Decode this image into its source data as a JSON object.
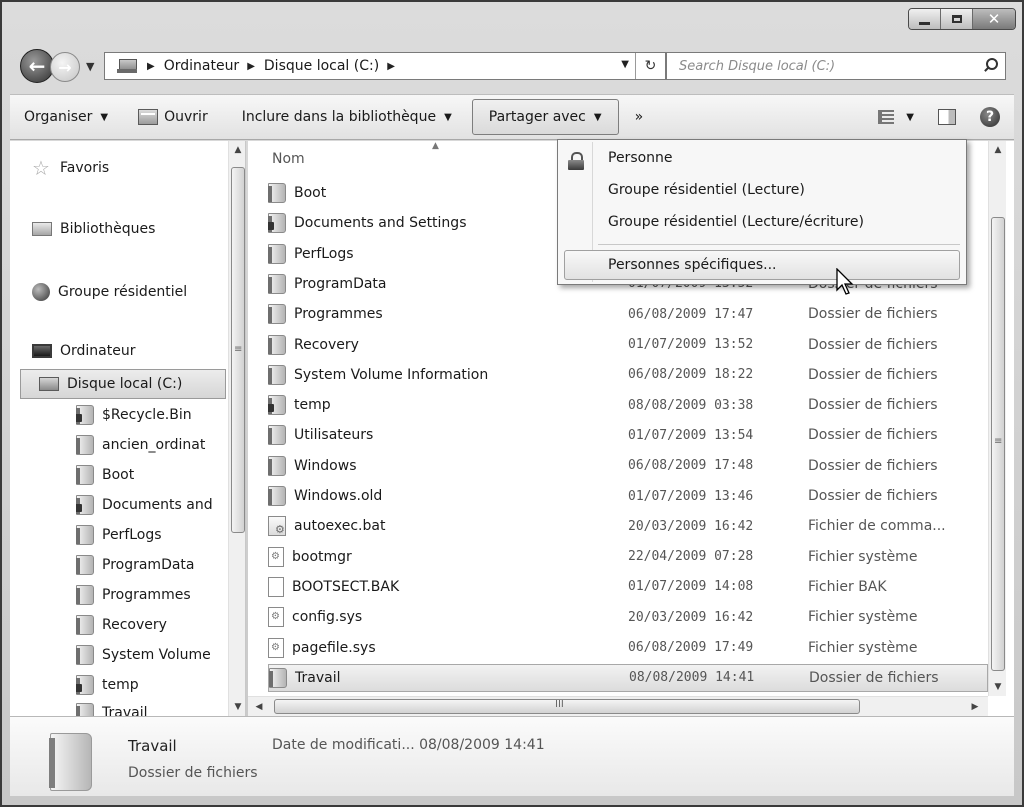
{
  "window": {
    "caption_buttons": [
      "minimize-icon",
      "maximize-icon",
      "close-icon"
    ],
    "close_glyph": "✕"
  },
  "address_bar": {
    "crumbs": [
      "Ordinateur",
      "Disque local (C:)"
    ],
    "dropdown_glyph": "▼",
    "refresh_glyph": "↻",
    "back_glyph": "←",
    "forward_glyph": "→"
  },
  "search": {
    "placeholder": "Search Disque local (C:)"
  },
  "commandbar": {
    "organize": "Organiser",
    "open": "Ouvrir",
    "include": "Inclure dans la bibliothèque",
    "share": "Partager avec",
    "more": "»"
  },
  "navpane": {
    "favorites": "Favoris",
    "libraries": "Bibliothèques",
    "homegroup": "Groupe résidentiel",
    "computer": "Ordinateur",
    "local_disk": "Disque local (C:)",
    "items": [
      "$Recycle.Bin",
      "ancien_ordinat",
      "Boot",
      "Documents and",
      "PerfLogs",
      "ProgramData",
      "Programmes",
      "Recovery",
      "System Volume",
      "temp",
      "Travail"
    ]
  },
  "filelist": {
    "column_name": "Nom",
    "rows": [
      {
        "name": "Boot",
        "date": "",
        "type": "",
        "icon": "folder"
      },
      {
        "name": "Documents and Settings",
        "date": "",
        "type": "",
        "icon": "folder-lock"
      },
      {
        "name": "PerfLogs",
        "date": "",
        "type": "",
        "icon": "folder"
      },
      {
        "name": "ProgramData",
        "date": "01/07/2009 13:52",
        "type": "Dossier de fichiers",
        "icon": "folder"
      },
      {
        "name": "Programmes",
        "date": "06/08/2009 17:47",
        "type": "Dossier de fichiers",
        "icon": "folder"
      },
      {
        "name": "Recovery",
        "date": "01/07/2009 13:52",
        "type": "Dossier de fichiers",
        "icon": "folder"
      },
      {
        "name": "System Volume Information",
        "date": "06/08/2009 18:22",
        "type": "Dossier de fichiers",
        "icon": "folder"
      },
      {
        "name": "temp",
        "date": "08/08/2009 03:38",
        "type": "Dossier de fichiers",
        "icon": "folder-lock"
      },
      {
        "name": "Utilisateurs",
        "date": "01/07/2009 13:54",
        "type": "Dossier de fichiers",
        "icon": "folder"
      },
      {
        "name": "Windows",
        "date": "06/08/2009 17:48",
        "type": "Dossier de fichiers",
        "icon": "folder"
      },
      {
        "name": "Windows.old",
        "date": "01/07/2009 13:46",
        "type": "Dossier de fichiers",
        "icon": "folder"
      },
      {
        "name": "autoexec.bat",
        "date": "20/03/2009 16:42",
        "type": "Fichier de comma...",
        "icon": "bat"
      },
      {
        "name": "bootmgr",
        "date": "22/04/2009 07:28",
        "type": "Fichier système",
        "icon": "sys"
      },
      {
        "name": "BOOTSECT.BAK",
        "date": "01/07/2009 14:08",
        "type": "Fichier BAK",
        "icon": "file"
      },
      {
        "name": "config.sys",
        "date": "20/03/2009 16:42",
        "type": "Fichier système",
        "icon": "sys"
      },
      {
        "name": "pagefile.sys",
        "date": "06/08/2009 17:49",
        "type": "Fichier système",
        "icon": "sys"
      },
      {
        "name": "Travail",
        "date": "08/08/2009 14:41",
        "type": "Dossier de fichiers",
        "icon": "folder",
        "selected": true
      }
    ]
  },
  "share_menu": {
    "items": [
      "Personne",
      "Groupe résidentiel (Lecture)",
      "Groupe résidentiel (Lecture/écriture)"
    ],
    "highlighted": "Personnes spécifiques..."
  },
  "details": {
    "name": "Travail",
    "modified": "Date de modificati... 08/08/2009 14:41",
    "type": "Dossier de fichiers"
  },
  "scroll_glyphs": {
    "up": "▲",
    "down": "▼",
    "left": "◀",
    "right": "▶",
    "grip_v": "≡",
    "grip_h": "III"
  }
}
